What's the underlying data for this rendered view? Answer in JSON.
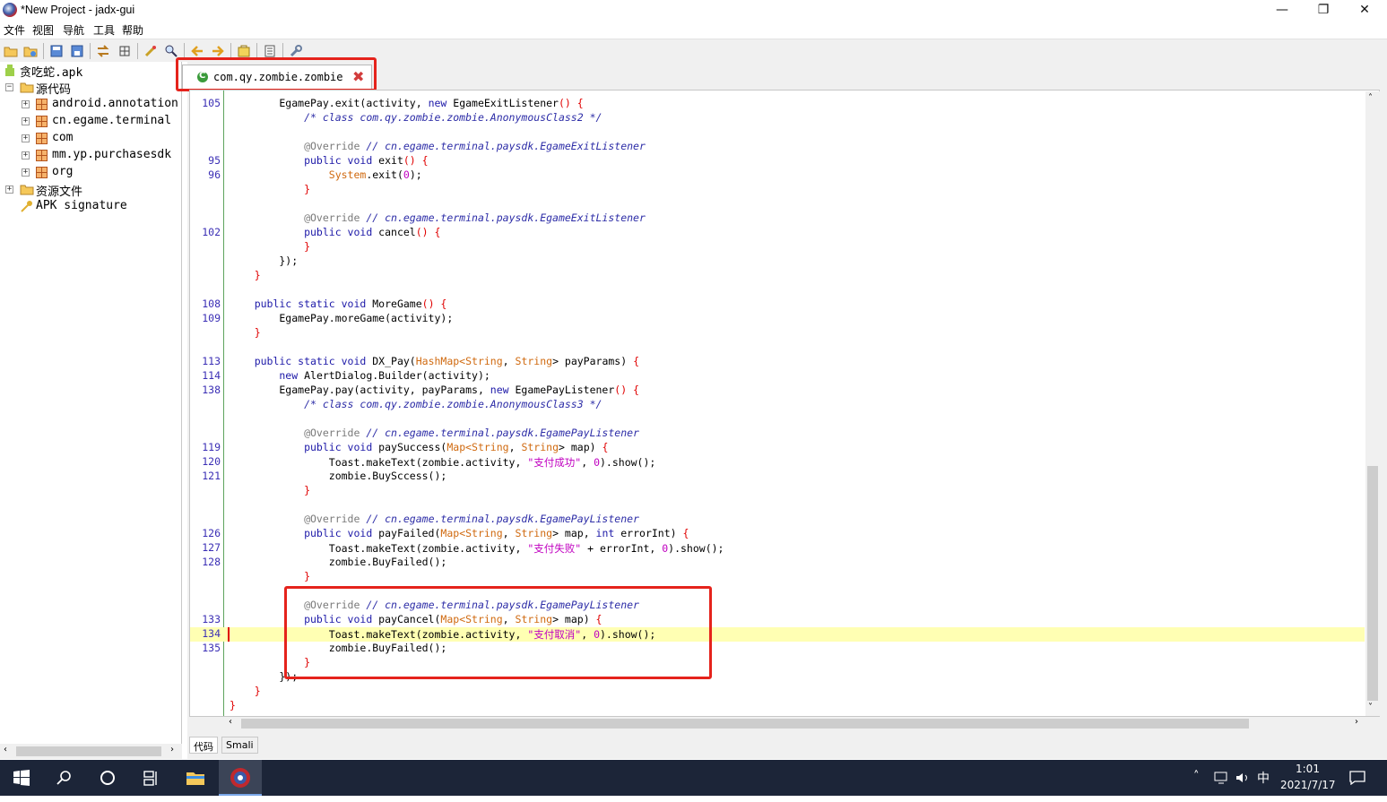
{
  "window": {
    "title": "*New Project - jadx-gui",
    "min": "—",
    "restore": "❐",
    "close": "✕"
  },
  "menu": [
    "文件",
    "视图",
    "导航",
    "工具",
    "帮助"
  ],
  "tree": {
    "root": "贪吃蛇.apk",
    "source": "源代码",
    "packages": [
      "android.annotation",
      "cn.egame.terminal",
      "com",
      "mm.yp.purchasesdk",
      "org"
    ],
    "resources": "资源文件",
    "signature": "APK signature"
  },
  "tab": {
    "label": "com.qy.zombie.zombie",
    "close": "✖"
  },
  "bottom_tabs": [
    "代码",
    "Smali"
  ],
  "code": [
    {
      "ln": "105",
      "t": [
        [
          "nm",
          "        EgamePay.exit(activity, "
        ],
        [
          "kw",
          "new"
        ],
        [
          "nm",
          " EgameExitListener"
        ],
        [
          "br",
          "() {"
        ]
      ]
    },
    {
      "ln": "",
      "t": [
        [
          "cm",
          "            /* class com.qy.zombie.zombie.AnonymousClass2 */"
        ]
      ]
    },
    {
      "ln": "",
      "t": []
    },
    {
      "ln": "",
      "t": [
        [
          "an",
          "            @Override"
        ],
        [
          "cm",
          " // cn.egame.terminal.paysdk.EgameExitListener"
        ]
      ]
    },
    {
      "ln": "95",
      "t": [
        [
          "kw",
          "            public void"
        ],
        [
          "nm",
          " exit"
        ],
        [
          "br",
          "() {"
        ]
      ]
    },
    {
      "ln": "96",
      "t": [
        [
          "ty",
          "                System"
        ],
        [
          "nm",
          ".exit("
        ],
        [
          "st",
          "0"
        ],
        [
          "nm",
          ");"
        ]
      ]
    },
    {
      "ln": "",
      "t": [
        [
          "br",
          "            }"
        ]
      ]
    },
    {
      "ln": "",
      "t": []
    },
    {
      "ln": "",
      "t": [
        [
          "an",
          "            @Override"
        ],
        [
          "cm",
          " // cn.egame.terminal.paysdk.EgameExitListener"
        ]
      ]
    },
    {
      "ln": "102",
      "t": [
        [
          "kw",
          "            public void"
        ],
        [
          "nm",
          " cancel"
        ],
        [
          "br",
          "() {"
        ]
      ]
    },
    {
      "ln": "",
      "t": [
        [
          "br",
          "            }"
        ]
      ]
    },
    {
      "ln": "",
      "t": [
        [
          "nm",
          "        });"
        ]
      ]
    },
    {
      "ln": "",
      "t": [
        [
          "br",
          "    }"
        ]
      ]
    },
    {
      "ln": "",
      "t": []
    },
    {
      "ln": "108",
      "t": [
        [
          "kw",
          "    public static void"
        ],
        [
          "nm",
          " MoreGame"
        ],
        [
          "br",
          "() {"
        ]
      ]
    },
    {
      "ln": "109",
      "t": [
        [
          "nm",
          "        EgamePay.moreGame(activity);"
        ]
      ]
    },
    {
      "ln": "",
      "t": [
        [
          "br",
          "    }"
        ]
      ]
    },
    {
      "ln": "",
      "t": []
    },
    {
      "ln": "113",
      "t": [
        [
          "kw",
          "    public static void"
        ],
        [
          "nm",
          " DX_Pay("
        ],
        [
          "ty",
          "HashMap<String"
        ],
        [
          "nm",
          ", "
        ],
        [
          "ty",
          "String"
        ],
        [
          "nm",
          "> payParams) "
        ],
        [
          "br",
          "{"
        ]
      ]
    },
    {
      "ln": "114",
      "t": [
        [
          "kw",
          "        new"
        ],
        [
          "nm",
          " AlertDialog.Builder(activity);"
        ]
      ]
    },
    {
      "ln": "138",
      "t": [
        [
          "nm",
          "        EgamePay.pay(activity, payParams, "
        ],
        [
          "kw",
          "new"
        ],
        [
          "nm",
          " EgamePayListener"
        ],
        [
          "br",
          "() {"
        ]
      ]
    },
    {
      "ln": "",
      "t": [
        [
          "cm",
          "            /* class com.qy.zombie.zombie.AnonymousClass3 */"
        ]
      ]
    },
    {
      "ln": "",
      "t": []
    },
    {
      "ln": "",
      "t": [
        [
          "an",
          "            @Override"
        ],
        [
          "cm",
          " // cn.egame.terminal.paysdk.EgamePayListener"
        ]
      ]
    },
    {
      "ln": "119",
      "t": [
        [
          "kw",
          "            public void"
        ],
        [
          "nm",
          " paySuccess("
        ],
        [
          "ty",
          "Map<String"
        ],
        [
          "nm",
          ", "
        ],
        [
          "ty",
          "String"
        ],
        [
          "nm",
          "> map) "
        ],
        [
          "br",
          "{"
        ]
      ]
    },
    {
      "ln": "120",
      "t": [
        [
          "nm",
          "                Toast.makeText(zombie.activity, "
        ],
        [
          "st",
          "\"支付成功\""
        ],
        [
          "nm",
          ", "
        ],
        [
          "st",
          "0"
        ],
        [
          "nm",
          ").show();"
        ]
      ]
    },
    {
      "ln": "121",
      "t": [
        [
          "nm",
          "                zombie.BuySccess();"
        ]
      ]
    },
    {
      "ln": "",
      "t": [
        [
          "br",
          "            }"
        ]
      ]
    },
    {
      "ln": "",
      "t": []
    },
    {
      "ln": "",
      "t": [
        [
          "an",
          "            @Override"
        ],
        [
          "cm",
          " // cn.egame.terminal.paysdk.EgamePayListener"
        ]
      ]
    },
    {
      "ln": "126",
      "t": [
        [
          "kw",
          "            public void"
        ],
        [
          "nm",
          " payFailed("
        ],
        [
          "ty",
          "Map<String"
        ],
        [
          "nm",
          ", "
        ],
        [
          "ty",
          "String"
        ],
        [
          "nm",
          "> map, "
        ],
        [
          "kw",
          "int"
        ],
        [
          "nm",
          " errorInt) "
        ],
        [
          "br",
          "{"
        ]
      ]
    },
    {
      "ln": "127",
      "t": [
        [
          "nm",
          "                Toast.makeText(zombie.activity, "
        ],
        [
          "st",
          "\"支付失败\""
        ],
        [
          "nm",
          " + errorInt, "
        ],
        [
          "st",
          "0"
        ],
        [
          "nm",
          ").show();"
        ]
      ]
    },
    {
      "ln": "128",
      "t": [
        [
          "nm",
          "                zombie.BuyFailed();"
        ]
      ]
    },
    {
      "ln": "",
      "t": [
        [
          "br",
          "            }"
        ]
      ]
    },
    {
      "ln": "",
      "t": []
    },
    {
      "ln": "",
      "t": [
        [
          "an",
          "            @Override"
        ],
        [
          "cm",
          " // cn.egame.terminal.paysdk.EgamePayListener"
        ]
      ]
    },
    {
      "ln": "133",
      "t": [
        [
          "kw",
          "            public void"
        ],
        [
          "nm",
          " payCancel("
        ],
        [
          "ty",
          "Map<String"
        ],
        [
          "nm",
          ", "
        ],
        [
          "ty",
          "String"
        ],
        [
          "nm",
          "> map) "
        ],
        [
          "br",
          "{"
        ]
      ]
    },
    {
      "ln": "134",
      "hl": true,
      "t": [
        [
          "nm",
          "                Toast.makeText(zombie.activity, "
        ],
        [
          "st",
          "\"支付取消\""
        ],
        [
          "nm",
          ", "
        ],
        [
          "st",
          "0"
        ],
        [
          "nm",
          ").show();"
        ]
      ]
    },
    {
      "ln": "135",
      "t": [
        [
          "nm",
          "                zombie.BuyFailed();"
        ]
      ]
    },
    {
      "ln": "",
      "t": [
        [
          "br",
          "            }"
        ]
      ]
    },
    {
      "ln": "",
      "t": [
        [
          "nm",
          "        });"
        ]
      ]
    },
    {
      "ln": "",
      "t": [
        [
          "br",
          "    }"
        ]
      ]
    },
    {
      "ln": "",
      "t": [
        [
          "br",
          "}"
        ]
      ]
    }
  ],
  "taskbar": {
    "time": "1:01",
    "date": "2021/7/17",
    "ime": "中"
  }
}
